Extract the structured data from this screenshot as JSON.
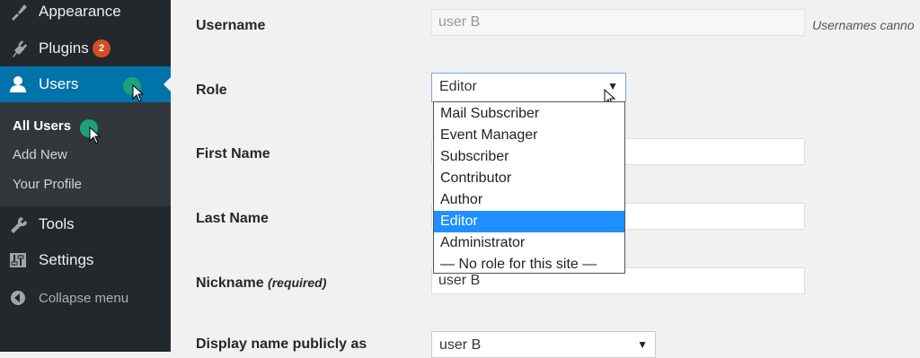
{
  "sidebar": {
    "appearance": "Appearance",
    "plugins": "Plugins",
    "plugins_badge": "2",
    "users": "Users",
    "submenu": {
      "all_users": "All Users",
      "add_new": "Add New",
      "your_profile": "Your Profile"
    },
    "tools": "Tools",
    "settings": "Settings",
    "collapse": "Collapse menu",
    "icons": {
      "appearance": "paintbrush-icon",
      "plugins": "plug-icon",
      "users": "user-icon",
      "tools": "wrench-icon",
      "settings": "settings-sliders-icon",
      "collapse": "collapse-arrow-icon"
    },
    "colors": {
      "background": "#23282d",
      "active": "#0073aa",
      "submenu": "#32373c",
      "badge": "#d54e21"
    }
  },
  "form": {
    "username": {
      "label": "Username",
      "value": "user B",
      "note": "Usernames canno"
    },
    "role": {
      "label": "Role",
      "selected": "Editor",
      "options": [
        "Mail Subscriber",
        "Event Manager",
        "Subscriber",
        "Contributor",
        "Author",
        "Editor",
        "Administrator",
        "— No role for this site —"
      ],
      "highlighted": "Editor"
    },
    "first_name": {
      "label": "First Name",
      "value": ""
    },
    "last_name": {
      "label": "Last Name",
      "value": ""
    },
    "nickname": {
      "label": "Nickname",
      "required": "(required)",
      "value": "user B"
    },
    "display_name": {
      "label": "Display name publicly as",
      "selected": "user B"
    }
  }
}
